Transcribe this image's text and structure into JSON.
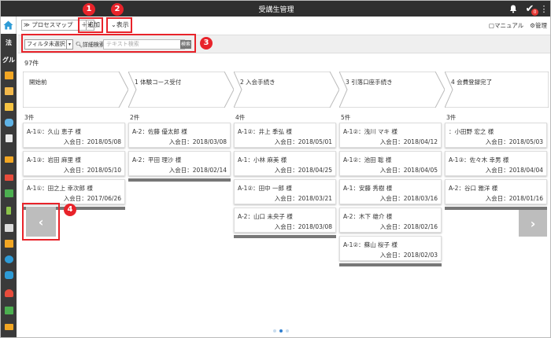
{
  "app": {
    "title": "受講生管理"
  },
  "header": {
    "notification_badge": "0"
  },
  "sidebar": {
    "items": [
      "法",
      "グル"
    ]
  },
  "toolbar": {
    "view_select": "≫ プロセスマップ",
    "add_label": "追加",
    "view_label": "表示",
    "manual_label": "マニュアル",
    "admin_label": "管理"
  },
  "filter": {
    "select_value": "フィルタ未選択",
    "advanced_label": "詳細検索",
    "search_placeholder": "テキスト検索",
    "search_button": "検索"
  },
  "total_count": "97件",
  "callouts": [
    "1",
    "2",
    "3",
    "4"
  ],
  "stages": [
    "開始前",
    "1 体験コース受付",
    "2 入会手続き",
    "3 引落口座手続き",
    "4 会費登録完了"
  ],
  "columns": [
    {
      "count": "3件",
      "cards": [
        {
          "name": "A-1①：久山 恵子 様",
          "date": "入会日：2018/05/08"
        },
        {
          "name": "A-1③：岩田 麻里 様",
          "date": "入会日：2018/05/10"
        },
        {
          "name": "A-1①：田之上 幸次郎 様",
          "date": "入会日：2017/06/26"
        }
      ]
    },
    {
      "count": "2件",
      "cards": [
        {
          "name": "A-2：佐藤 優太郎 様",
          "date": "入会日：2018/03/08"
        },
        {
          "name": "A-2：平田 理沙 様",
          "date": "入会日：2018/02/14"
        }
      ]
    },
    {
      "count": "4件",
      "cards": [
        {
          "name": "A-1②：井上 季弘 様",
          "date": "入会日：2018/05/01"
        },
        {
          "name": "A-1：小林 麻美 様",
          "date": "入会日：2018/04/25"
        },
        {
          "name": "A-1②：田中 一郎 様",
          "date": "入会日：2018/03/21"
        },
        {
          "name": "A-2：山口 未央子 様",
          "date": "入会日：2018/03/08"
        }
      ]
    },
    {
      "count": "5件",
      "cards": [
        {
          "name": "A-1②：浅川 マキ 様",
          "date": "入会日：2018/04/12"
        },
        {
          "name": "A-1②：池田 聡 様",
          "date": "入会日：2018/04/05"
        },
        {
          "name": "A-1：安藤 秀樹 様",
          "date": "入会日：2018/03/16"
        },
        {
          "name": "A-2：木下 雄介 様",
          "date": "入会日：2018/02/16"
        },
        {
          "name": "A-1②：蘇山 桜子 様",
          "date": "入会日：2018/02/03"
        }
      ]
    },
    {
      "count": "3件",
      "cards": [
        {
          "name": "：小田野 宏之 様",
          "date": "入会日：2018/05/03"
        },
        {
          "name": "A-1③：佐々木 幸男 様",
          "date": "入会日：2018/04/04"
        },
        {
          "name": "A-2：谷口 雅洋 様",
          "date": "入会日：2018/01/16"
        }
      ]
    }
  ],
  "colors": {
    "titlebar": "#2f2f2f",
    "callout": "#e8232a",
    "dot_active": "#2f7fd0"
  }
}
